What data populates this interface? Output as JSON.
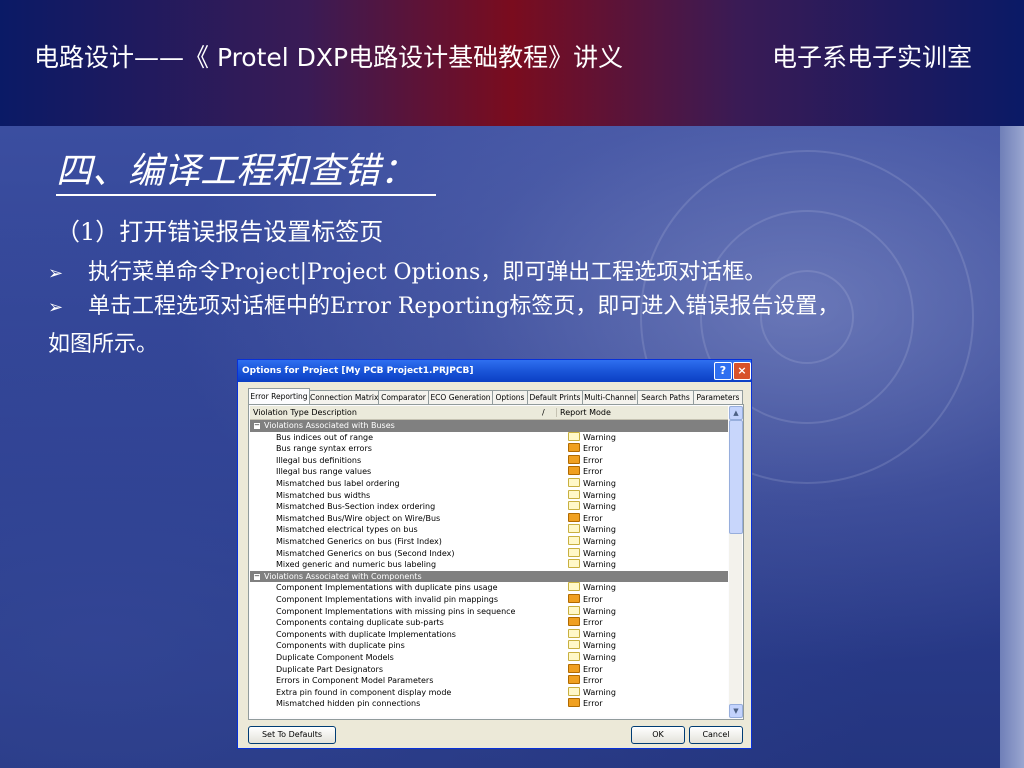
{
  "header": {
    "title": "电路设计——《 Protel DXP电路设计基础教程》讲义",
    "dept": "电子系电子实训室"
  },
  "slide": {
    "title": "四、编译工程和查错：",
    "subtitle": "（1）打开错误报告设置标签页",
    "bullets": [
      "执行菜单命令Project|Project Options，即可弹出工程选项对话框。",
      "单击工程选项对话框中的Error Reporting标签页，即可进入错误报告设置，"
    ],
    "continuation": "如图所示。",
    "bullet_glyph": "➢"
  },
  "dialog": {
    "title": "Options for Project [My PCB Project1.PRJPCB]",
    "help_btn": "?",
    "close_btn": "×",
    "tabs": [
      "Error Reporting",
      "Connection Matrix",
      "Comparator",
      "ECO Generation",
      "Options",
      "Default Prints",
      "Multi-Channel",
      "Search Paths",
      "Parameters"
    ],
    "active_tab": "Error Reporting",
    "columns": {
      "desc": "Violation Type Description",
      "mode": "Report Mode",
      "sort_glyph": "/"
    },
    "groups": [
      {
        "label": "Violations Associated with Buses",
        "expander": "−",
        "rows": [
          {
            "desc": "Bus indices out of range",
            "mode": "Warning"
          },
          {
            "desc": "Bus range syntax errors",
            "mode": "Error"
          },
          {
            "desc": "Illegal bus definitions",
            "mode": "Error"
          },
          {
            "desc": "Illegal bus range values",
            "mode": "Error"
          },
          {
            "desc": "Mismatched bus label ordering",
            "mode": "Warning"
          },
          {
            "desc": "Mismatched bus widths",
            "mode": "Warning"
          },
          {
            "desc": "Mismatched Bus-Section index ordering",
            "mode": "Warning"
          },
          {
            "desc": "Mismatched Bus/Wire object on Wire/Bus",
            "mode": "Error"
          },
          {
            "desc": "Mismatched electrical types on bus",
            "mode": "Warning"
          },
          {
            "desc": "Mismatched Generics on bus (First Index)",
            "mode": "Warning"
          },
          {
            "desc": "Mismatched Generics on bus (Second Index)",
            "mode": "Warning"
          },
          {
            "desc": "Mixed generic and numeric bus labeling",
            "mode": "Warning"
          }
        ]
      },
      {
        "label": "Violations Associated with Components",
        "expander": "−",
        "rows": [
          {
            "desc": "Component Implementations with duplicate pins usage",
            "mode": "Warning"
          },
          {
            "desc": "Component Implementations with invalid pin mappings",
            "mode": "Error"
          },
          {
            "desc": "Component Implementations with missing pins in sequence",
            "mode": "Warning"
          },
          {
            "desc": "Components containg duplicate sub-parts",
            "mode": "Error"
          },
          {
            "desc": "Components with duplicate Implementations",
            "mode": "Warning"
          },
          {
            "desc": "Components with duplicate pins",
            "mode": "Warning"
          },
          {
            "desc": "Duplicate Component Models",
            "mode": "Warning"
          },
          {
            "desc": "Duplicate Part Designators",
            "mode": "Error"
          },
          {
            "desc": "Errors in Component Model Parameters",
            "mode": "Error"
          },
          {
            "desc": "Extra pin found in component display mode",
            "mode": "Warning"
          },
          {
            "desc": "Mismatched hidden pin connections",
            "mode": "Error"
          }
        ]
      }
    ],
    "scroll_up": "▲",
    "scroll_down": "▼",
    "buttons": {
      "defaults": "Set To Defaults",
      "ok": "OK",
      "cancel": "Cancel"
    }
  }
}
